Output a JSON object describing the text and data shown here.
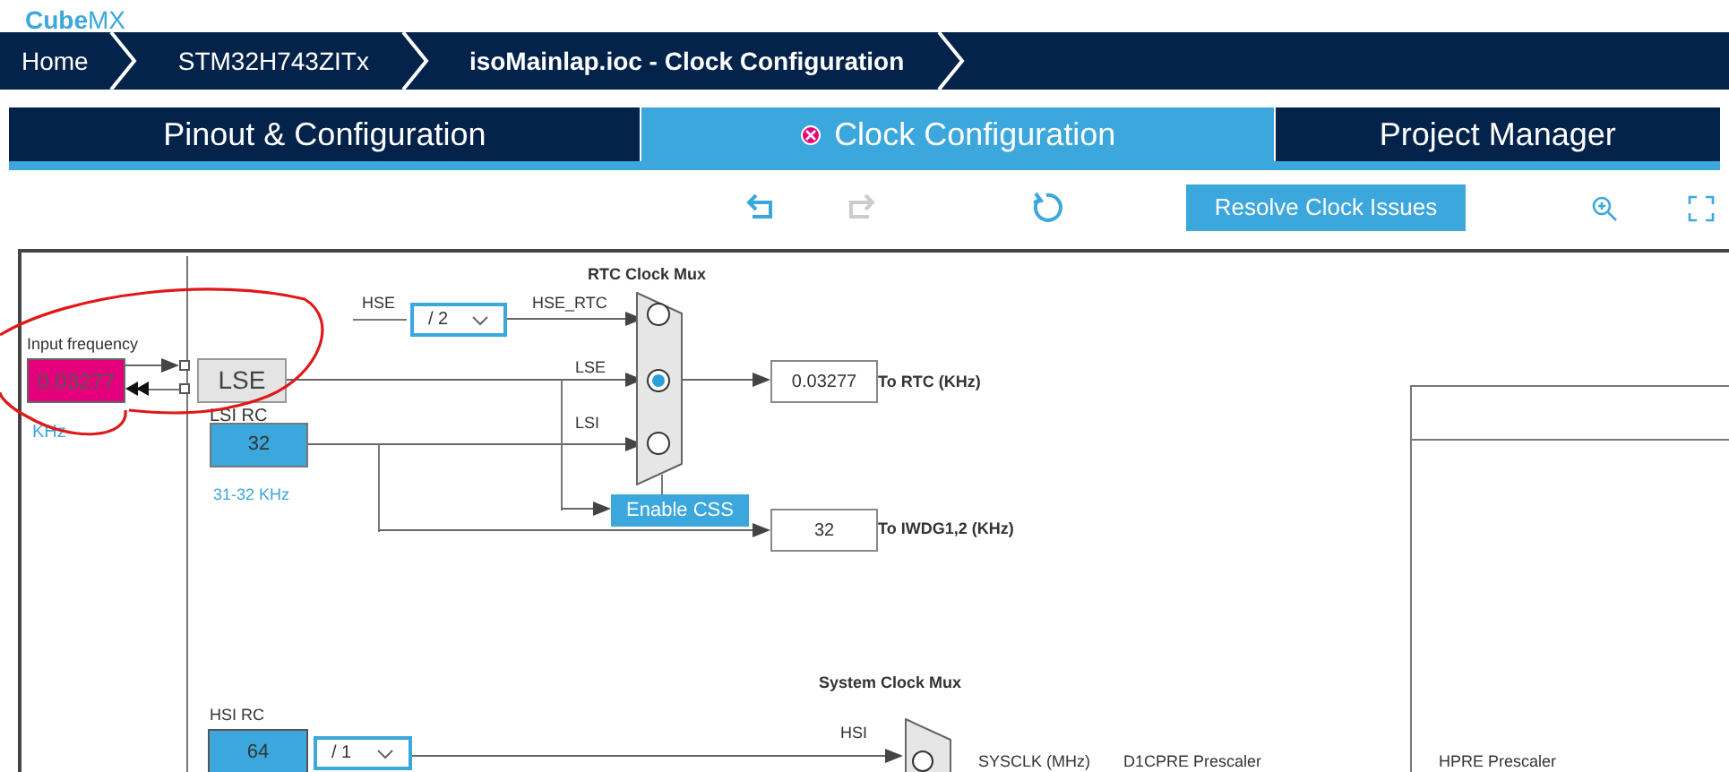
{
  "logo": {
    "bold": "Cube",
    "light": "MX"
  },
  "breadcrumbs": [
    {
      "label": "Home",
      "current": false
    },
    {
      "label": "STM32H743ZITx",
      "current": false
    },
    {
      "label": "isoMainlap.ioc - Clock Configuration",
      "current": true
    }
  ],
  "tabs": [
    {
      "label": "Pinout & Configuration",
      "selected": false,
      "error": false
    },
    {
      "label": "Clock Configuration",
      "selected": true,
      "error": true
    },
    {
      "label": "Project Manager",
      "selected": false,
      "error": false
    }
  ],
  "toolbar": {
    "undo": {
      "disabled": false
    },
    "redo": {
      "disabled": true
    },
    "resolve_button": "Resolve Clock Issues"
  },
  "lse": {
    "input_label": "Input frequency",
    "input_value": "0.03277",
    "unit": "KHz",
    "label": "LSE"
  },
  "lsi": {
    "label": "LSI RC",
    "value": "32",
    "range": "31-32 KHz"
  },
  "hse_divider": {
    "source": "HSE",
    "value": "/ 2"
  },
  "rtc_mux": {
    "title": "RTC Clock Mux",
    "inputs": [
      {
        "label": "HSE_RTC",
        "selected": false
      },
      {
        "label": "LSE",
        "selected": true
      },
      {
        "label": "LSI",
        "selected": false
      }
    ],
    "css_button": "Enable CSS"
  },
  "outputs": [
    {
      "value": "0.03277",
      "label": "To RTC (KHz)"
    },
    {
      "value": "32",
      "label": "To IWDG1,2 (KHz)"
    }
  ],
  "hsi": {
    "label": "HSI RC",
    "value": "64",
    "divider": "/ 1"
  },
  "system_mux": {
    "title": "System Clock Mux",
    "inputs": [
      {
        "label": "HSI",
        "selected": false
      }
    ]
  },
  "bottom_labels": [
    "SYSCLK (MHz)",
    "D1CPRE Prescaler",
    "HPRE Prescaler"
  ]
}
